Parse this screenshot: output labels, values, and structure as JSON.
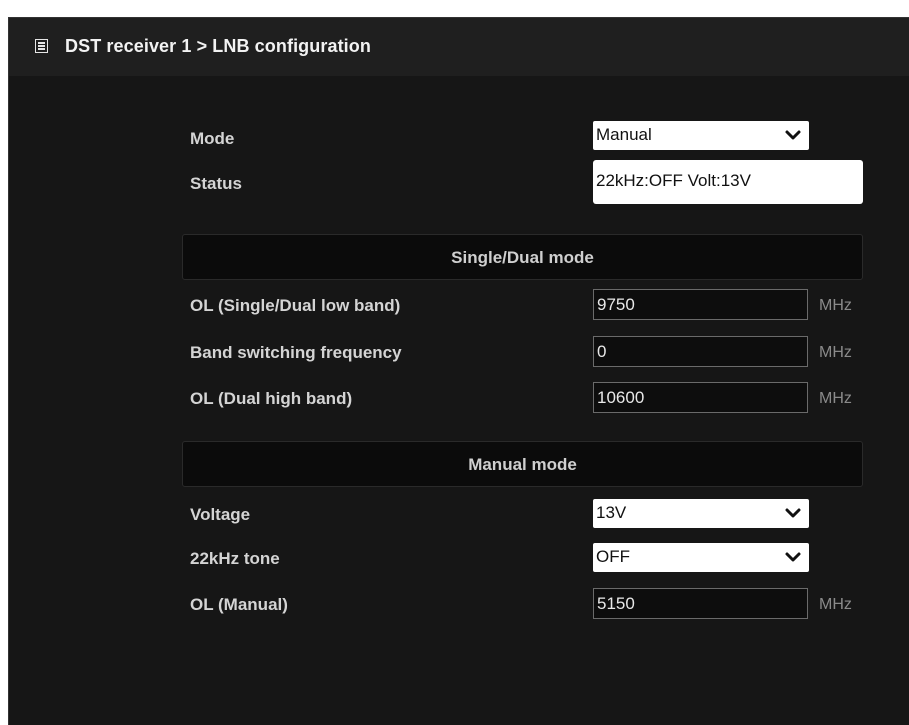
{
  "header": {
    "title": "DST receiver 1 > LNB configuration",
    "icon": "list-icon"
  },
  "fields": {
    "mode": {
      "label": "Mode",
      "value": "Manual"
    },
    "status": {
      "label": "Status",
      "value": "22kHz:OFF Volt:13V"
    }
  },
  "single_dual": {
    "heading": "Single/Dual mode",
    "ol_low": {
      "label": "OL (Single/Dual low band)",
      "value": "9750",
      "unit": "MHz"
    },
    "band_switch": {
      "label": "Band switching frequency",
      "value": "0",
      "unit": "MHz"
    },
    "ol_high": {
      "label": "OL (Dual high band)",
      "value": "10600",
      "unit": "MHz"
    }
  },
  "manual": {
    "heading": "Manual mode",
    "voltage": {
      "label": "Voltage",
      "value": "13V"
    },
    "tone": {
      "label": "22kHz tone",
      "value": "OFF"
    },
    "ol_manual": {
      "label": "OL (Manual)",
      "value": "5150",
      "unit": "MHz"
    }
  },
  "colors": {
    "panel_bg": "#161616",
    "title_bg": "#1f1f1f",
    "section_bg": "#0b0b0b"
  }
}
